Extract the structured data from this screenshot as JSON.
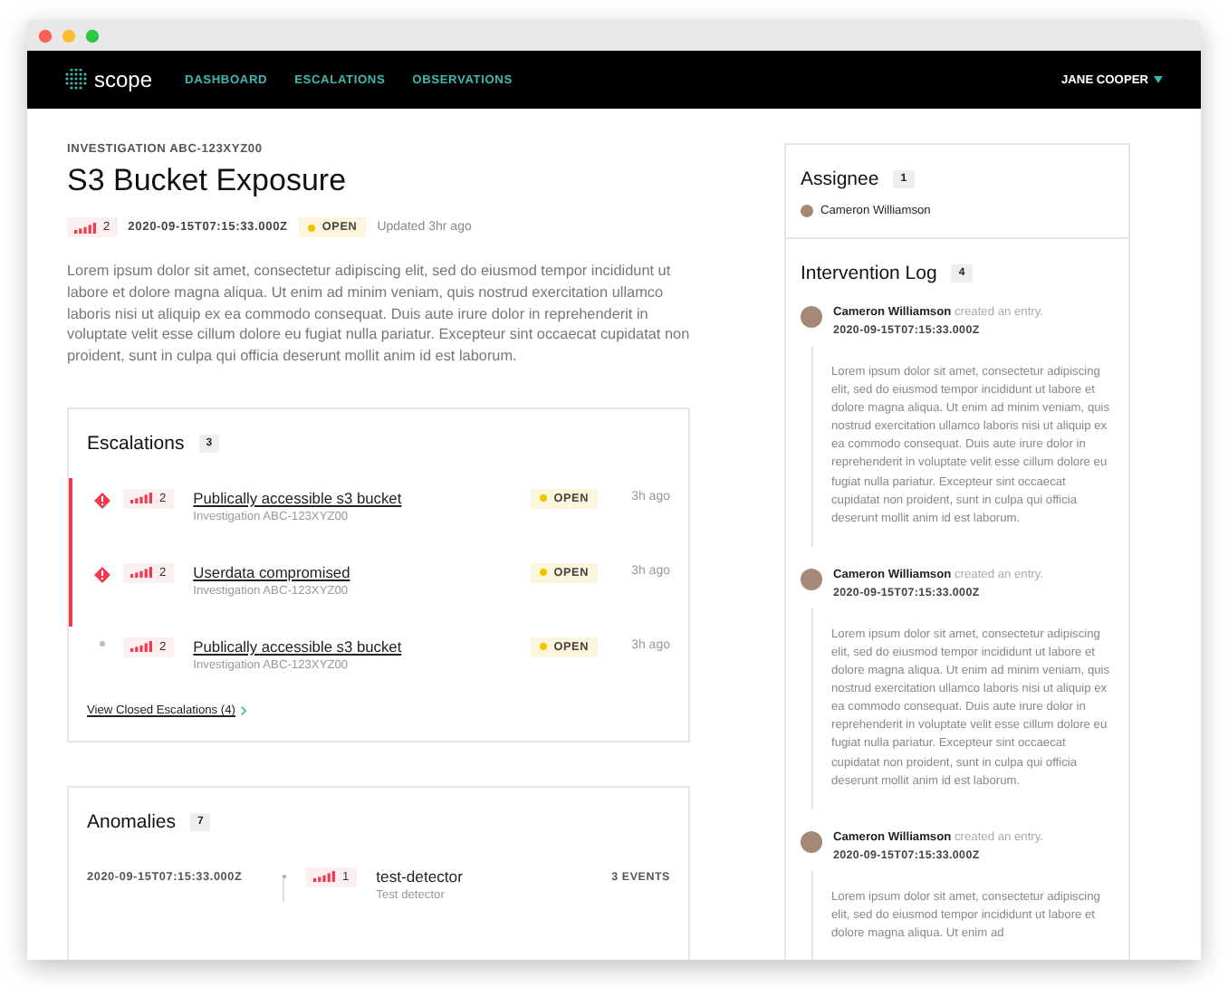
{
  "nav": {
    "logo": "scope",
    "links": [
      "DASHBOARD",
      "ESCALATIONS",
      "OBSERVATIONS"
    ],
    "user": "JANE COOPER"
  },
  "investigation": {
    "id_label": "INVESTIGATION ABC-123XYZ00",
    "title": "S3 Bucket Exposure",
    "severity": "2",
    "timestamp": "2020-09-15T07:15:33.000Z",
    "status": "OPEN",
    "updated": "Updated 3hr ago",
    "description": "Lorem ipsum dolor sit amet, consectetur adipiscing elit, sed do eiusmod tempor incididunt ut labore et dolore magna aliqua. Ut enim ad minim veniam, quis nostrud exercitation ullamco laboris nisi ut aliquip ex ea commodo consequat. Duis aute irure dolor in reprehenderit in voluptate velit esse cillum dolore eu fugiat nulla pariatur. Excepteur sint occaecat cupidatat non proident, sunt in culpa qui officia deserunt mollit anim id est laborum."
  },
  "escalations": {
    "title": "Escalations",
    "count": "3",
    "items": [
      {
        "flagged": true,
        "severity": "2",
        "title": "Publically accessible s3 bucket",
        "subtitle": "Investigation ABC-123XYZ00",
        "status": "OPEN",
        "time": "3h ago"
      },
      {
        "flagged": true,
        "severity": "2",
        "title": "Userdata compromised",
        "subtitle": "Investigation ABC-123XYZ00",
        "status": "OPEN",
        "time": "3h ago"
      },
      {
        "flagged": false,
        "severity": "2",
        "title": "Publically accessible s3 bucket",
        "subtitle": "Investigation ABC-123XYZ00",
        "status": "OPEN",
        "time": "3h ago"
      }
    ],
    "view_closed": "View Closed Escalations (4)"
  },
  "anomalies": {
    "title": "Anomalies",
    "count": "7",
    "items": [
      {
        "timestamp": "2020-09-15T07:15:33.000Z",
        "severity": "1",
        "name": "test-detector",
        "description": "Test detector",
        "events": "3 EVENTS"
      }
    ]
  },
  "assignee": {
    "title": "Assignee",
    "count": "1",
    "people": [
      "Cameron Williamson"
    ]
  },
  "log": {
    "title": "Intervention Log",
    "count": "4",
    "entries": [
      {
        "author": "Cameron Williamson",
        "action": "created an entry.",
        "timestamp": "2020-09-15T07:15:33.000Z",
        "text": "Lorem ipsum dolor sit amet, consectetur adipiscing elit, sed do eiusmod tempor incididunt ut labore et dolore magna aliqua. Ut enim ad minim veniam, quis nostrud exercitation ullamco laboris nisi ut aliquip ex ea commodo consequat. Duis aute irure dolor in reprehenderit in voluptate velit esse cillum dolore eu fugiat nulla pariatur. Excepteur sint occaecat cupidatat non proident, sunt in culpa qui officia deserunt mollit anim id est laborum."
      },
      {
        "author": "Cameron Williamson",
        "action": "created an entry.",
        "timestamp": "2020-09-15T07:15:33.000Z",
        "text": "Lorem ipsum dolor sit amet, consectetur adipiscing elit, sed do eiusmod tempor incididunt ut labore et dolore magna aliqua. Ut enim ad minim veniam, quis nostrud exercitation ullamco laboris nisi ut aliquip ex ea commodo consequat. Duis aute irure dolor in reprehenderit in voluptate velit esse cillum dolore eu fugiat nulla pariatur. Excepteur sint occaecat cupidatat non proident, sunt in culpa qui officia deserunt mollit anim id est laborum."
      },
      {
        "author": "Cameron Williamson",
        "action": "created an entry.",
        "timestamp": "2020-09-15T07:15:33.000Z",
        "text": "Lorem ipsum dolor sit amet, consectetur adipiscing elit, sed do eiusmod tempor incididunt ut labore et dolore magna aliqua. Ut enim ad"
      }
    ]
  }
}
